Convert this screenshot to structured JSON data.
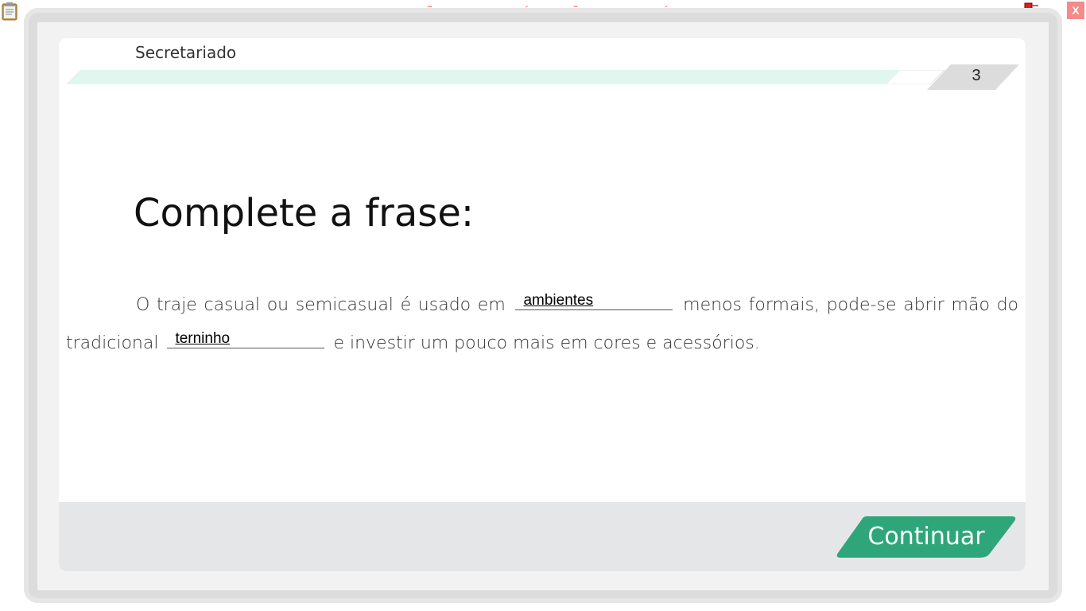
{
  "window": {
    "banner": "VERSÃO PARA FUNCIONÁRIOS - NÃO COMERCIALIZÁVEL",
    "close_label": "X",
    "icons": [
      "clipboard-icon",
      "network-status-icon"
    ]
  },
  "header": {
    "course_title": "Secretariado",
    "page_number": "3",
    "progress_fraction": 0.95
  },
  "question": {
    "title": "Complete a frase:",
    "part1": "O traje casual ou semicasual é usado em",
    "blank1": "ambientes",
    "part2": "menos formais, pode-se abrir mão do tradicional",
    "blank2": "terninho",
    "part3": "e investir um pouco mais em cores e acessórios."
  },
  "footer": {
    "continue_label": "Continuar"
  },
  "colors": {
    "accent": "#2ea67a",
    "progress": "#dff7ef",
    "banner_text": "#f26b6b",
    "close_bg": "#f48a8a"
  }
}
